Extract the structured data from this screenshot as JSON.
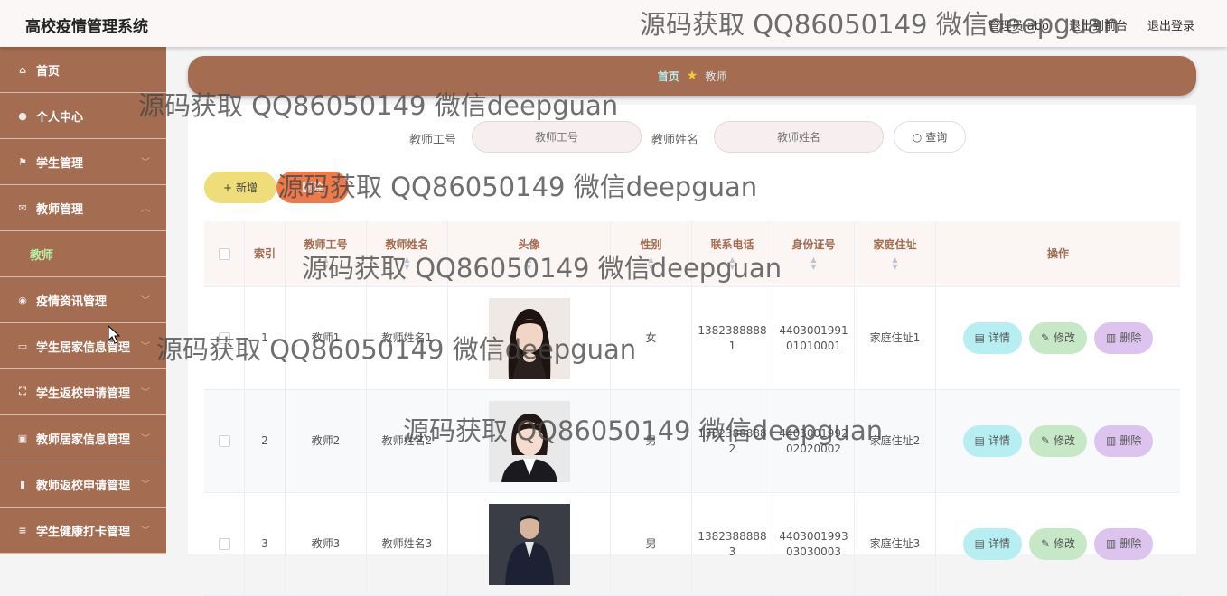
{
  "header": {
    "title": "高校疫情管理系统",
    "admin": "管理员 abo",
    "front": "退出到前台",
    "logout": "退出登录"
  },
  "watermark": "源码获取 QQ86050149 微信deepguan",
  "sidebar": {
    "items": [
      {
        "label": "首页",
        "icon": "home-icon"
      },
      {
        "label": "个人中心",
        "icon": "user-icon"
      },
      {
        "label": "学生管理",
        "icon": "flag-icon"
      },
      {
        "label": "教师管理",
        "icon": "mail-icon"
      },
      {
        "label": "疫情资讯管理",
        "icon": "location-icon"
      },
      {
        "label": "学生居家信息管理",
        "icon": "chat-icon"
      },
      {
        "label": "学生返校申请管理",
        "icon": "fullscreen-icon"
      },
      {
        "label": "教师居家信息管理",
        "icon": "chart-icon"
      },
      {
        "label": "教师返校申请管理",
        "icon": "bar-chart-icon"
      },
      {
        "label": "学生健康打卡管理",
        "icon": "list-icon"
      }
    ],
    "sub_item": "教师"
  },
  "breadcrumb": {
    "home": "首页",
    "current": "教师"
  },
  "search": {
    "teacher_no_label": "教师工号",
    "teacher_no_placeholder": "教师工号",
    "teacher_name_label": "教师姓名",
    "teacher_name_placeholder": "教师姓名",
    "query": "查询"
  },
  "actions": {
    "add": "新增",
    "delete": "删除"
  },
  "table": {
    "columns": [
      "索引",
      "教师工号",
      "教师姓名",
      "头像",
      "性别",
      "联系电话",
      "身份证号",
      "家庭住址",
      "操作"
    ],
    "rows": [
      {
        "idx": "1",
        "no": "教师1",
        "name": "教师姓名1",
        "sex": "女",
        "phone": "13823888881",
        "id": "440300199101010001",
        "addr": "家庭住址1"
      },
      {
        "idx": "2",
        "no": "教师2",
        "name": "教师姓名2",
        "sex": "男",
        "phone": "13823888882",
        "id": "440300199202020002",
        "addr": "家庭住址2"
      },
      {
        "idx": "3",
        "no": "教师3",
        "name": "教师姓名3",
        "sex": "男",
        "phone": "13823888883",
        "id": "440300199303030003",
        "addr": "家庭住址3"
      }
    ],
    "op_detail": "详情",
    "op_edit": "修改",
    "op_delete": "删除"
  }
}
